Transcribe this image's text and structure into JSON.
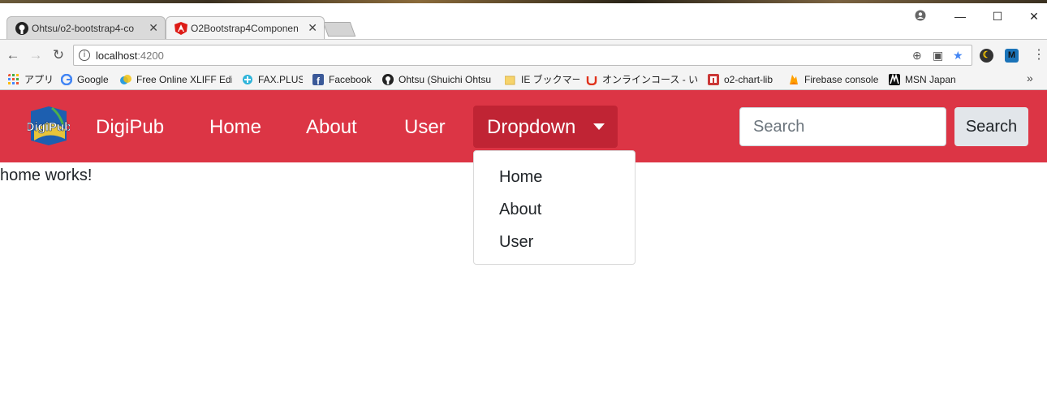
{
  "browser": {
    "tabs": [
      {
        "title": "Ohtsu/o2-bootstrap4-co",
        "icon": "github-icon",
        "active": false
      },
      {
        "title": "O2Bootstrap4Componen",
        "icon": "angular-icon",
        "active": true
      }
    ],
    "address": {
      "host": "localhost",
      "port": ":4200"
    },
    "bookmarks": [
      {
        "label": "アプリ",
        "icon": "apps-grid-icon"
      },
      {
        "label": "Google",
        "icon": "google-icon"
      },
      {
        "label": "Free Online XLIFF Edi",
        "icon": "xliff-icon"
      },
      {
        "label": "FAX.PLUS",
        "icon": "fax-plus-icon"
      },
      {
        "label": "Facebook",
        "icon": "facebook-icon"
      },
      {
        "label": "Ohtsu (Shuichi Ohtsu",
        "icon": "github-icon"
      },
      {
        "label": "IE ブックマーク",
        "icon": "folder-icon"
      },
      {
        "label": "オンラインコース - いつで",
        "icon": "udemy-icon"
      },
      {
        "label": "o2-chart-lib",
        "icon": "npm-icon"
      },
      {
        "label": "Firebase console",
        "icon": "firebase-icon"
      },
      {
        "label": "MSN Japan",
        "icon": "msn-icon"
      }
    ],
    "more_bookmarks": "»"
  },
  "navbar": {
    "brand": "DigiPub",
    "logo_text": "DigiPub",
    "links": [
      "Home",
      "About",
      "User"
    ],
    "dropdown_label": "Dropdown",
    "search_placeholder": "Search",
    "search_button": "Search",
    "color": "#dc3545"
  },
  "dropdown_menu": {
    "items": [
      "Home",
      "About",
      "User"
    ]
  },
  "content": {
    "text": "home works!"
  }
}
